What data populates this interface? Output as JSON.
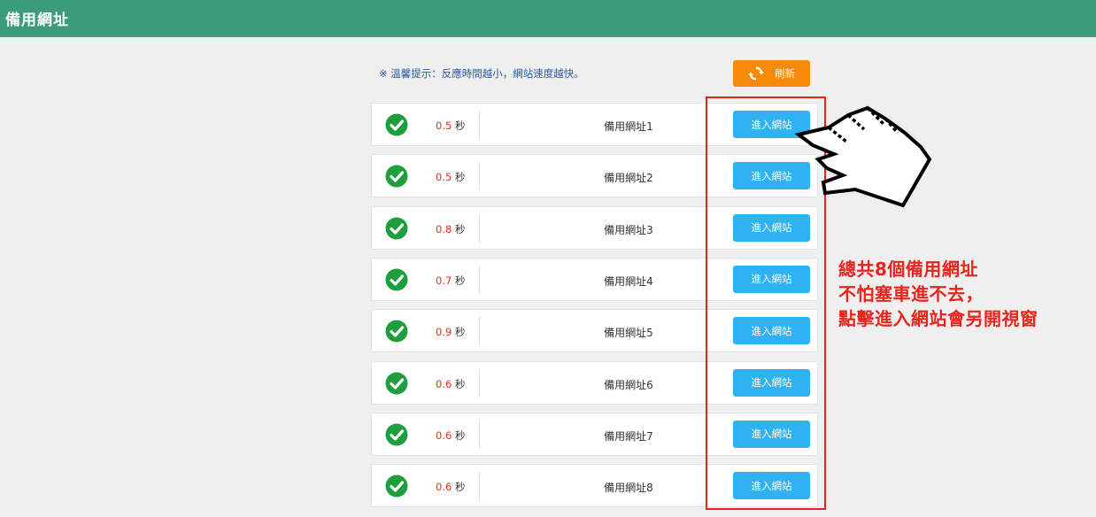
{
  "header": {
    "title": "備用網址"
  },
  "tip": {
    "text": "※ 溫馨提示：反應時間越小，網站速度越快。"
  },
  "refresh": {
    "label": "刷新",
    "icon": "refresh-icon"
  },
  "unit": "秒",
  "rows": [
    {
      "speed": "0.5",
      "label": "備用網址1",
      "button": "進入網站"
    },
    {
      "speed": "0.5",
      "label": "備用網址2",
      "button": "進入網站"
    },
    {
      "speed": "0.8",
      "label": "備用網址3",
      "button": "進入網站"
    },
    {
      "speed": "0.7",
      "label": "備用網址4",
      "button": "進入網站"
    },
    {
      "speed": "0.9",
      "label": "備用網址5",
      "button": "進入網站"
    },
    {
      "speed": "0.6",
      "label": "備用網址6",
      "button": "進入網站"
    },
    {
      "speed": "0.6",
      "label": "備用網址7",
      "button": "進入網站"
    },
    {
      "speed": "0.6",
      "label": "備用網址8",
      "button": "進入網站"
    }
  ],
  "annotation": {
    "lines": [
      "總共8個備用網址",
      "不怕塞車進不去，",
      "點擊進入網站會另開視窗"
    ]
  },
  "colors": {
    "header": "#3a9c78",
    "refresh_button": "#f58a0b",
    "enter_button": "#2fb2f2",
    "check": "#1e9e3c",
    "speed_number": "#e0301e",
    "annotation": "#e8241c"
  }
}
